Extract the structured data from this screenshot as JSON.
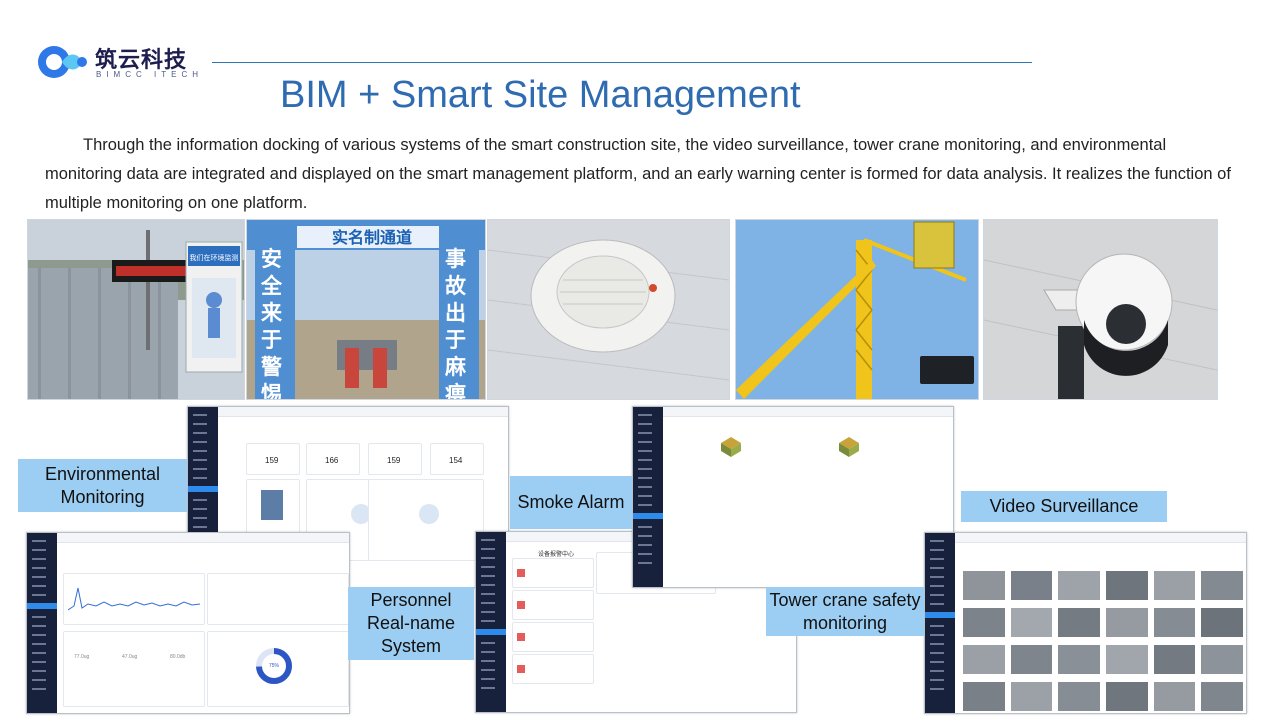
{
  "brand": {
    "name_cn": "筑云科技",
    "name_en": "BIMCC ITECH",
    "color": "#1d1d4f"
  },
  "title": "BIM + Smart Site Management",
  "intro": "Through the information docking of various systems of the smart construction site, the video surveillance, tower crane monitoring, and environmental monitoring data are integrated and displayed on the smart management platform, and an early warning center is formed for data analysis. It realizes the function of multiple monitoring on one platform.",
  "photos": [
    {
      "subject": "environmental-monitoring-station",
      "sign_text": "我们在环境监测"
    },
    {
      "subject": "real-name-entrance-gate",
      "top_sign": "实名制通道",
      "left_sign": "安全来于警惕",
      "right_sign": "事故出于麻痹"
    },
    {
      "subject": "smoke-detector"
    },
    {
      "subject": "tower-crane-monitor"
    },
    {
      "subject": "dome-security-camera"
    }
  ],
  "labels": {
    "environmental": "Environmental Monitoring",
    "smoke": "Smoke Alarm",
    "video": "Video Surveillance",
    "personnel": "Personnel Real-name System",
    "tower": "Tower crane safety monitoring"
  },
  "screens": {
    "personnel": {
      "stats": [
        "159",
        "166",
        "159",
        "154"
      ]
    },
    "smoke": {
      "header": "设备报警中心"
    },
    "env": {
      "gauge": "75%",
      "readings": [
        "77.0ug",
        "47.0ug",
        "80.0db"
      ]
    }
  },
  "colors": {
    "accent": "#2e6bb0",
    "label_bg": "#9ccdf2",
    "sidebar": "#17213b",
    "highlight": "#2f8bea"
  }
}
